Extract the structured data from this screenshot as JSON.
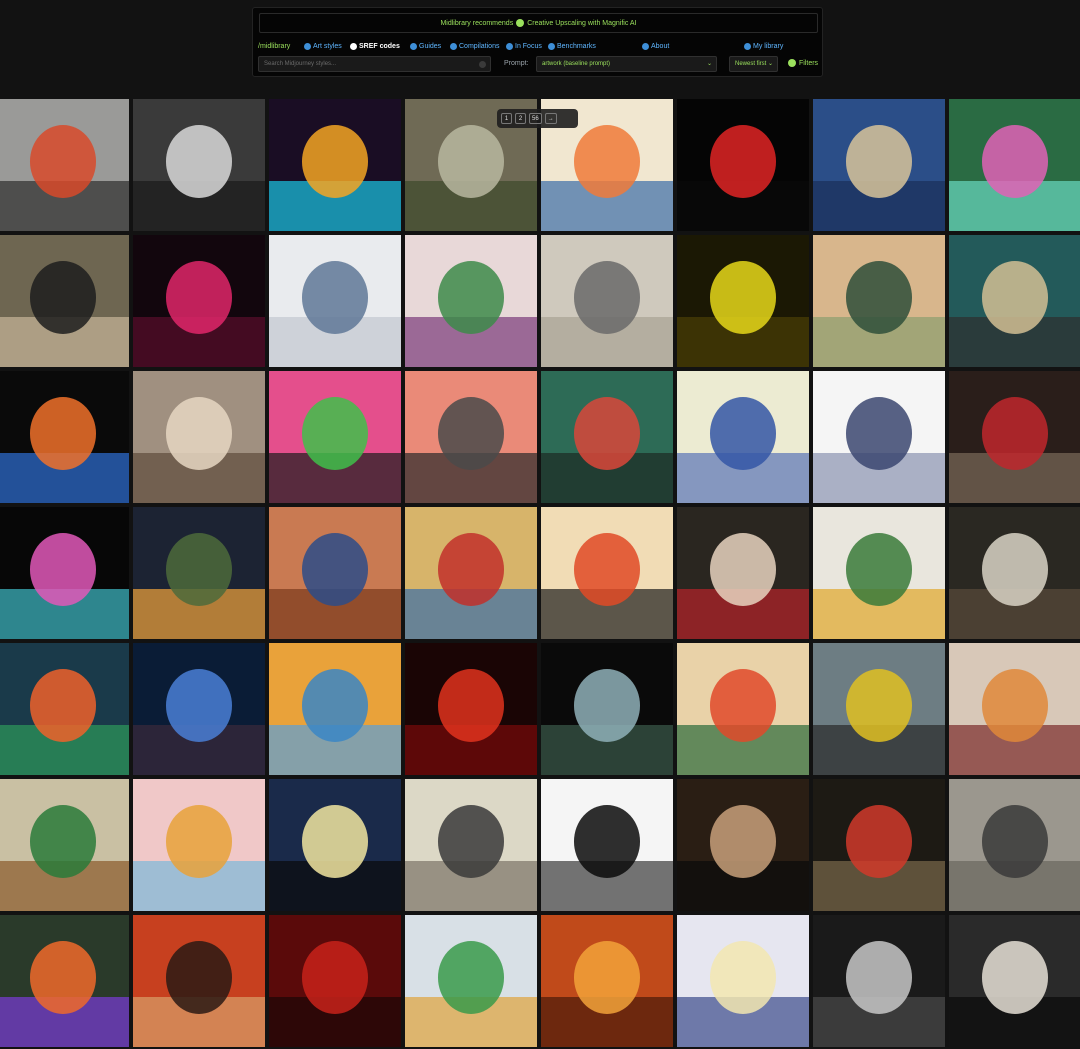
{
  "promo": {
    "prefix": "Midlibrary recommends",
    "link": "Creative Upscaling with Magnific AI"
  },
  "nav": {
    "brand": "/midlibrary",
    "items": [
      {
        "label": "Art styles",
        "icon": "palette-icon"
      },
      {
        "label": "SREF codes",
        "icon": "code-icon",
        "active": true
      },
      {
        "label": "Guides",
        "icon": "book-icon"
      },
      {
        "label": "Compilations",
        "icon": "stack-icon"
      },
      {
        "label": "In Focus",
        "icon": "focus-icon"
      },
      {
        "label": "Benchmarks",
        "icon": "chart-icon"
      },
      {
        "label": "About",
        "icon": "info-icon"
      },
      {
        "label": "My library",
        "icon": "library-icon"
      }
    ]
  },
  "controls": {
    "search_placeholder": "Search Midjourney styles...",
    "prompt_label": "Prompt:",
    "prompt_value": "artwork (baseline prompt)",
    "sort_value": "Newest first",
    "filters_label": "Filters"
  },
  "pager": {
    "pages": [
      "1",
      "2",
      "56"
    ],
    "next_icon": "→"
  },
  "gallery": {
    "tiles": [
      {
        "bg": "#9a9a98",
        "a": "#d84a2a",
        "b": "#2d2d2d"
      },
      {
        "bg": "#3a3a3a",
        "a": "#d9d9d9",
        "b": "#1a1a1a"
      },
      {
        "bg": "#1a0d24",
        "a": "#f5a623",
        "b": "#1ac7e6"
      },
      {
        "bg": "#6f6a55",
        "a": "#b9b7a0",
        "b": "#3d4a2b"
      },
      {
        "bg": "#f1e7d0",
        "a": "#f07a3a",
        "b": "#3b6ca8"
      },
      {
        "bg": "#050505",
        "a": "#e02424",
        "b": "#0a0a0a"
      },
      {
        "bg": "#2b4e88",
        "a": "#d8c49a",
        "b": "#1b2f5a"
      },
      {
        "bg": "#2a6b43",
        "a": "#e062b6",
        "b": "#6ad9c0"
      },
      {
        "bg": "#6e6651",
        "a": "#1d1d1d",
        "b": "#c8b79a"
      },
      {
        "bg": "#12060d",
        "a": "#e0276a",
        "b": "#5a0e2c"
      },
      {
        "bg": "#e9ebee",
        "a": "#5f7896",
        "b": "#c2c8d0"
      },
      {
        "bg": "#e8d8d8",
        "a": "#3d8b4a",
        "b": "#7a3a7a"
      },
      {
        "bg": "#cfc9bd",
        "a": "#6a6a6a",
        "b": "#a8a294"
      },
      {
        "bg": "#1b1804",
        "a": "#e6d81a",
        "b": "#4a3f06"
      },
      {
        "bg": "#d8b68c",
        "a": "#2f4f3a",
        "b": "#8c9e6e"
      },
      {
        "bg": "#235a5a",
        "a": "#d2c094",
        "b": "#2d2d2d"
      },
      {
        "bg": "#0a0a0a",
        "a": "#f0712a",
        "b": "#2d6fd6"
      },
      {
        "bg": "#a09080",
        "a": "#e6d7c2",
        "b": "#5e4b3c"
      },
      {
        "bg": "#e44f8c",
        "a": "#3fbf4a",
        "b": "#1d1d1d"
      },
      {
        "bg": "#ea8a78",
        "a": "#4a4a4a",
        "b": "#2a2a2a"
      },
      {
        "bg": "#2d6b56",
        "a": "#d9463a",
        "b": "#1d2a24"
      },
      {
        "bg": "#ecebd2",
        "a": "#3456a6",
        "b": "#5a74b6"
      },
      {
        "bg": "#f5f5f5",
        "a": "#3b4770",
        "b": "#8a93b1"
      },
      {
        "bg": "#2a1e1a",
        "a": "#c0272d",
        "b": "#7a6a5a"
      },
      {
        "bg": "#070707",
        "a": "#e058b8",
        "b": "#3fbcc7"
      },
      {
        "bg": "#1c2333",
        "a": "#4c6a3b",
        "b": "#f2a43a"
      },
      {
        "bg": "#c97a52",
        "a": "#2d4c88",
        "b": "#7a3a1d"
      },
      {
        "bg": "#d7b46a",
        "a": "#c2302a",
        "b": "#3a6ea8"
      },
      {
        "bg": "#f1dcb5",
        "a": "#e04a26",
        "b": "#1d1d1d"
      },
      {
        "bg": "#2a2620",
        "a": "#e8d4c0",
        "b": "#b8222a"
      },
      {
        "bg": "#e9e6dd",
        "a": "#3a7a3a",
        "b": "#e0a62a"
      },
      {
        "bg": "#2a2822",
        "a": "#d9d4c6",
        "b": "#5a4a3a"
      },
      {
        "bg": "#1a3a4a",
        "a": "#f0612a",
        "b": "#2d9a5a"
      },
      {
        "bg": "#0a1c36",
        "a": "#4a7fd6",
        "b": "#3a2a3a"
      },
      {
        "bg": "#e9a23a",
        "a": "#3a86c6",
        "b": "#5aa0d8"
      },
      {
        "bg": "#1a0505",
        "a": "#e0331d",
        "b": "#7a0a0a"
      },
      {
        "bg": "#0a0a0a",
        "a": "#8fb0b8",
        "b": "#3a5a4a"
      },
      {
        "bg": "#e9d2a8",
        "a": "#e04a2a",
        "b": "#2a6a3a"
      },
      {
        "bg": "#6d7d83",
        "a": "#e0c022",
        "b": "#2a2a2a"
      },
      {
        "bg": "#d8c8b8",
        "a": "#e0883a",
        "b": "#7a2a2a"
      },
      {
        "bg": "#c9c0a3",
        "a": "#2a7a3a",
        "b": "#8a5a2a"
      },
      {
        "bg": "#f0c8c8",
        "a": "#e8a23a",
        "b": "#7ab8d8"
      },
      {
        "bg": "#1a2a4a",
        "a": "#f2e6a0",
        "b": "#0a0a0a"
      },
      {
        "bg": "#dcd8c6",
        "a": "#3a3a3a",
        "b": "#7a7466"
      },
      {
        "bg": "#f5f5f5",
        "a": "#0a0a0a",
        "b": "#3a3a3a"
      },
      {
        "bg": "#2a1e14",
        "a": "#c8a07a",
        "b": "#0a0a0a"
      },
      {
        "bg": "#1d1a14",
        "a": "#d03a2a",
        "b": "#7a6a4a"
      },
      {
        "bg": "#9b978e",
        "a": "#3a3a3a",
        "b": "#6a665e"
      },
      {
        "bg": "#2a3a2a",
        "a": "#f06a2a",
        "b": "#7a3ad8"
      },
      {
        "bg": "#c7401f",
        "a": "#2a1a14",
        "b": "#d8a06a"
      },
      {
        "bg": "#5a0a0a",
        "a": "#c8221a",
        "b": "#1a0505"
      },
      {
        "bg": "#d8e0e6",
        "a": "#3a9a4a",
        "b": "#e0a23a"
      },
      {
        "bg": "#c04a1a",
        "a": "#f2a23a",
        "b": "#4a1a0a"
      },
      {
        "bg": "#e6e6f0",
        "a": "#f2e6b0",
        "b": "#3a4a8a"
      },
      {
        "bg": "#1a1a1a",
        "a": "#c8c8c8",
        "b": "#4a4a4a"
      },
      {
        "bg": "#2a2a2a",
        "a": "#e6e0d6",
        "b": "#0a0a0a"
      }
    ]
  }
}
